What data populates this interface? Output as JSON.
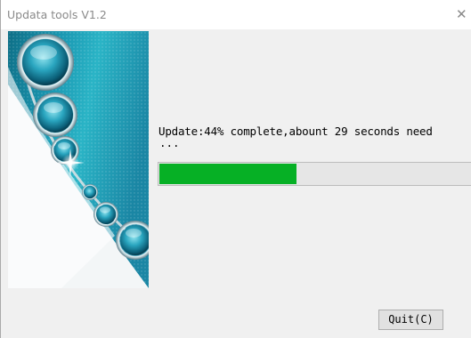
{
  "window": {
    "title": "Updata tools V1.2",
    "close_glyph": "✕",
    "close_icon": "close-icon"
  },
  "banner": {
    "image": "blue-glass-orbs-decoration",
    "colors": {
      "teal": "#1aa0b8",
      "dark_teal": "#0d6f86",
      "white": "#f4f6f6"
    }
  },
  "status": {
    "message": "Update:44% complete,abount 29 seconds need",
    "ellipsis": "..."
  },
  "progress": {
    "percent": 44,
    "fill_color": "#06b025",
    "track_color": "#e6e6e6"
  },
  "buttons": {
    "quit_label": "Quit(C)"
  }
}
